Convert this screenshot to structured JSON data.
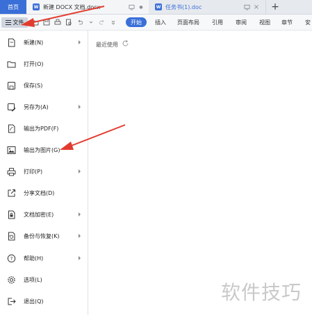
{
  "tabbar": {
    "home_label": "首页",
    "tabs": [
      {
        "icon": "W",
        "name": "新建 DOCX 文档.docx"
      },
      {
        "icon": "W",
        "name": "任务书(1).doc"
      }
    ],
    "new_tab": "+"
  },
  "ribbon": {
    "file_label": "文件",
    "start_label": "开始",
    "tabs": [
      "插入",
      "页面布局",
      "引用",
      "审阅",
      "视图",
      "章节",
      "安"
    ]
  },
  "file_menu": {
    "items": [
      {
        "label": "新建(N)",
        "icon": "new-doc-icon",
        "submenu": true
      },
      {
        "label": "打开(O)",
        "icon": "folder-icon",
        "submenu": false
      },
      {
        "label": "保存(S)",
        "icon": "save-icon",
        "submenu": false
      },
      {
        "label": "另存为(A)",
        "icon": "save-as-icon",
        "submenu": true
      },
      {
        "label": "输出为PDF(F)",
        "icon": "pdf-icon",
        "submenu": false
      },
      {
        "label": "输出为图片(G)",
        "icon": "image-icon",
        "submenu": false
      },
      {
        "label": "打印(P)",
        "icon": "printer-icon",
        "submenu": true
      },
      {
        "label": "分享文档(D)",
        "icon": "share-icon",
        "submenu": false
      },
      {
        "label": "文档加密(E)",
        "icon": "lock-icon",
        "submenu": true
      },
      {
        "label": "备份与恢复(K)",
        "icon": "backup-icon",
        "submenu": true
      },
      {
        "label": "帮助(H)",
        "icon": "help-icon",
        "submenu": true
      },
      {
        "label": "选项(L)",
        "icon": "gear-icon",
        "submenu": false
      },
      {
        "label": "退出(Q)",
        "icon": "exit-icon",
        "submenu": false
      }
    ]
  },
  "recent": {
    "title": "最近使用"
  },
  "watermark": "软件技巧",
  "colors": {
    "accent": "#3a6fd8",
    "arrow": "#e23b2e"
  }
}
